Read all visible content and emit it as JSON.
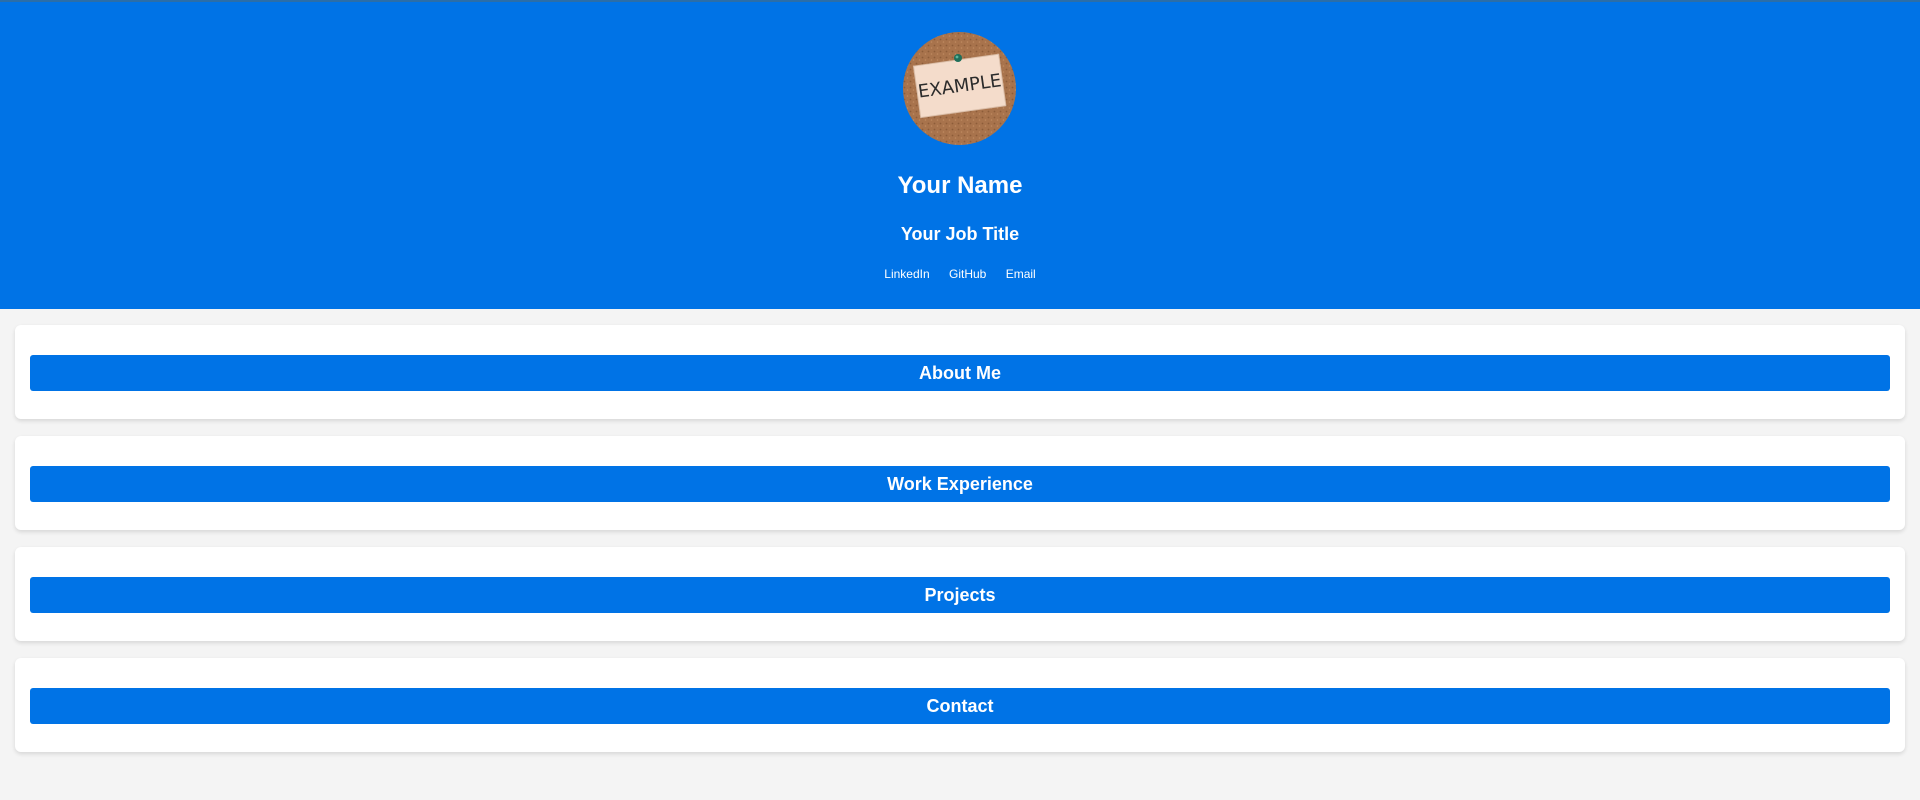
{
  "colors": {
    "hero_bg": "#0073e6",
    "page_bg": "#f4f4f4",
    "section_bar": "#0073e6",
    "text_light": "#ffffff"
  },
  "profile": {
    "avatar_icon": "example-pinned-note-image",
    "avatar_text": "EXAMPLE",
    "name": "Your Name",
    "job_title": "Your Job Title",
    "links": [
      "LinkedIn",
      "GitHub",
      "Email"
    ]
  },
  "sections": [
    "About Me",
    "Work Experience",
    "Projects",
    "Contact"
  ]
}
